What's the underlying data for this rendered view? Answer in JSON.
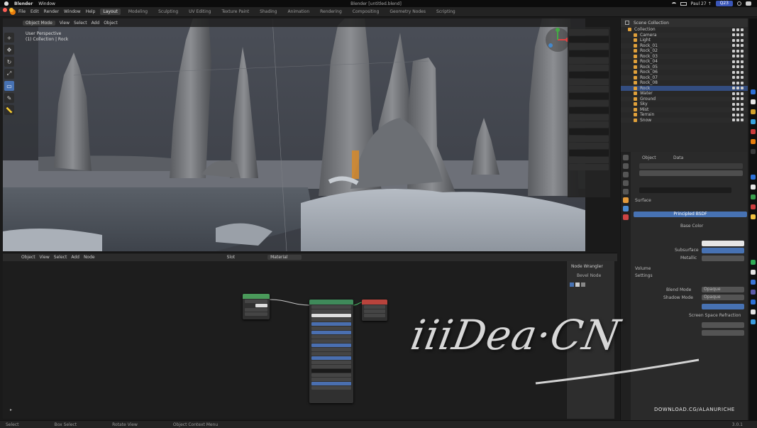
{
  "mac_menubar": {
    "app_name": "Blender",
    "window_menu": "Window",
    "window_title": "Blender [untitled.blend]",
    "user_label": "Paul 27 ↑",
    "status_pill": "Q23"
  },
  "menubar": {
    "items": [
      "File",
      "Edit",
      "Render",
      "Window",
      "Help"
    ],
    "workspaces": [
      "Layout",
      "Modeling",
      "Sculpting",
      "UV Editing",
      "Texture Paint",
      "Shading",
      "Animation",
      "Rendering",
      "Compositing",
      "Geometry Nodes",
      "Scripting"
    ],
    "active_workspace": "Layout"
  },
  "viewport": {
    "mode": "Object Mode",
    "menus": [
      "View",
      "Select",
      "Add",
      "Object"
    ],
    "overlay_title": "User Perspective",
    "overlay_subtitle": "(1) Collection | Rock"
  },
  "outliner": {
    "title": "Scene Collection",
    "rows": [
      "Collection",
      "Camera",
      "Light",
      "Rock_01",
      "Rock_02",
      "Rock_03",
      "Rock_04",
      "Rock_05",
      "Rock_06",
      "Rock_07",
      "Rock_08",
      "Rock",
      "Water",
      "Ground",
      "Sky",
      "Mist",
      "Terrain",
      "Snow"
    ],
    "selected_row": "Rock"
  },
  "properties": {
    "tab_labels": [
      "Object",
      "Data"
    ],
    "section_surface": "Surface",
    "surface_button": "Principled BSDF",
    "base_color_label": "Base Color",
    "subsurface_label": "Subsurface",
    "metallic_label": "Metallic",
    "volume_label": "Volume",
    "settings_label": "Settings",
    "blend_mode_label": "Blend Mode",
    "blend_mode_value": "Opaque",
    "shadow_mode_label": "Shadow Mode",
    "shadow_mode_value": "Opaque",
    "extra": "Screen Space Refraction"
  },
  "node_editor": {
    "menus": [
      "View",
      "Select",
      "Add",
      "Node"
    ],
    "object_label": "Object",
    "slot_label": "Slot",
    "material_label": "Material",
    "nodes": [
      {
        "title": "Image Texture",
        "color": "#4a9a5a"
      },
      {
        "title": "Principled BSDF",
        "color": "#3f8a5a"
      },
      {
        "title": "Material Output",
        "color": "#b8433c"
      }
    ],
    "sidebar_title": "Node Wrangler",
    "sidebar_item": "Bevel Node"
  },
  "statusbar": {
    "items": [
      "Select",
      "Box Select",
      "Rotate View",
      "Object Context Menu"
    ],
    "version": "3.0.1"
  },
  "watermark": {
    "text": "iiiDea·CN",
    "download": "DOWNLOAD.CG/ALANURICHE"
  },
  "colors": {
    "accent": "#4772b3",
    "orange": "#e87d0d",
    "selection": "#334d80"
  }
}
